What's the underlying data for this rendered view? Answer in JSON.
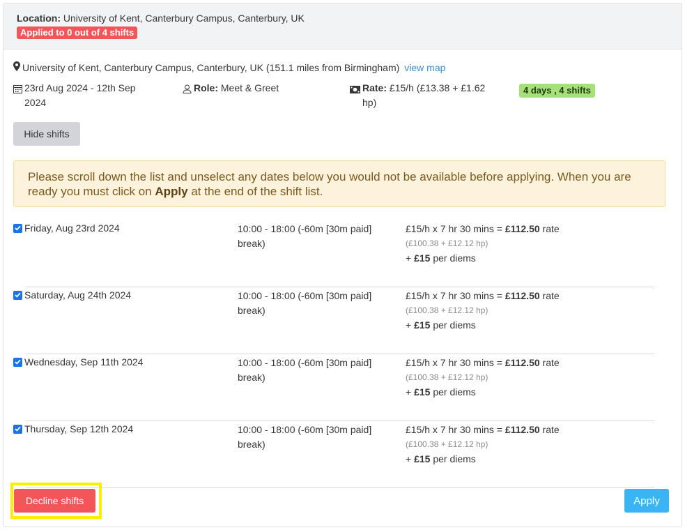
{
  "header": {
    "location_label": "Location:",
    "location_value": "University of Kent, Canterbury Campus, Canterbury, UK",
    "applied_badge": "Applied to 0 out of 4 shifts"
  },
  "details": {
    "address": "University of Kent, Canterbury Campus, Canterbury, UK (151.1 miles from Birmingham)",
    "view_map": "view map",
    "date_range": "23rd Aug 2024  -  12th Sep 2024",
    "role_label": "Role:",
    "role_value": "Meet & Greet",
    "rate_label": "Rate:",
    "rate_value": "£15/h (£13.38 + £1.62 hp)",
    "days_badge": "4 days , 4 shifts"
  },
  "hide_shifts_label": "Hide shifts",
  "notice": {
    "text_before": "Please scroll down the list and unselect any dates below you would not be available before applying. When you are ready you must click on ",
    "bold": "Apply",
    "text_after": " at the end of the shift list."
  },
  "shifts": [
    {
      "date": "Friday, Aug 23rd 2024",
      "time": "10:00 - 18:00 (-60m [30m paid] break)",
      "rate_prefix": "£15/h x 7 hr 30 mins = ",
      "rate_total": "£112.50",
      "rate_suffix": " rate",
      "breakdown": "(£100.38 + £12.12 hp)",
      "per_diem_prefix": "+ ",
      "per_diem_amount": "£15",
      "per_diem_suffix": " per diems",
      "checked": true
    },
    {
      "date": "Saturday, Aug 24th 2024",
      "time": "10:00 - 18:00 (-60m [30m paid] break)",
      "rate_prefix": "£15/h x 7 hr 30 mins = ",
      "rate_total": "£112.50",
      "rate_suffix": " rate",
      "breakdown": "(£100.38 + £12.12 hp)",
      "per_diem_prefix": "+ ",
      "per_diem_amount": "£15",
      "per_diem_suffix": " per diems",
      "checked": true
    },
    {
      "date": "Wednesday, Sep 11th 2024",
      "time": "10:00 - 18:00 (-60m [30m paid] break)",
      "rate_prefix": "£15/h x 7 hr 30 mins = ",
      "rate_total": "£112.50",
      "rate_suffix": " rate",
      "breakdown": "(£100.38 + £12.12 hp)",
      "per_diem_prefix": "+ ",
      "per_diem_amount": "£15",
      "per_diem_suffix": " per diems",
      "checked": true
    },
    {
      "date": "Thursday, Sep 12th 2024",
      "time": "10:00 - 18:00 (-60m [30m paid] break)",
      "rate_prefix": "£15/h x 7 hr 30 mins = ",
      "rate_total": "£112.50",
      "rate_suffix": " rate",
      "breakdown": "(£100.38 + £12.12 hp)",
      "per_diem_prefix": "+ ",
      "per_diem_amount": "£15",
      "per_diem_suffix": " per diems",
      "checked": true
    }
  ],
  "footer": {
    "decline_label": "Decline shifts",
    "apply_label": "Apply"
  },
  "colors": {
    "danger": "#f25659",
    "info": "#3ab4f2",
    "success_badge": "#a6e07a",
    "link": "#3e8ed0",
    "highlight": "#ffee00"
  },
  "icons": [
    "map-marker-icon",
    "calendar-icon",
    "user-icon",
    "money-icon",
    "checkbox-checked-icon"
  ]
}
